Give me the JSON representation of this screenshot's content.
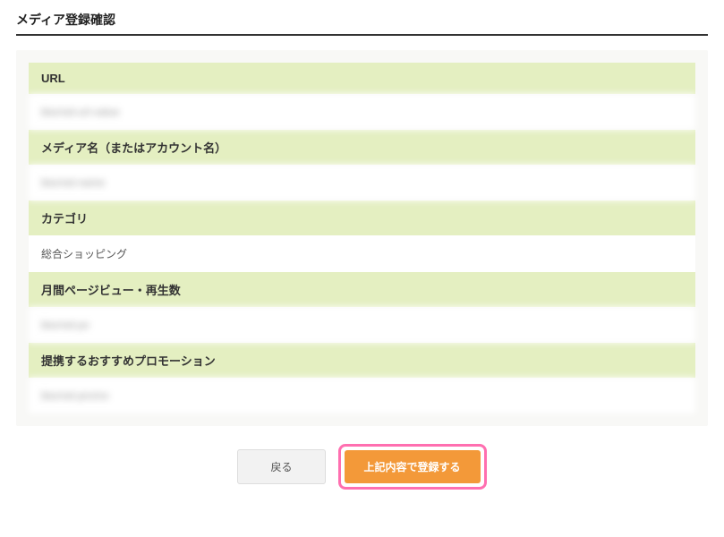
{
  "page": {
    "title": "メディア登録確認"
  },
  "fields": {
    "url": {
      "label": "URL",
      "value": "blurred-url-value"
    },
    "media_name": {
      "label": "メディア名（またはアカウント名）",
      "value": "blurred-name"
    },
    "category": {
      "label": "カテゴリ",
      "value": "総合ショッピング"
    },
    "pageviews": {
      "label": "月間ページビュー・再生数",
      "value": "blurred-pv"
    },
    "promotion": {
      "label": "提携するおすすめプロモーション",
      "value": "blurred-promo"
    }
  },
  "buttons": {
    "back": "戻る",
    "submit": "上記内容で登録する"
  }
}
